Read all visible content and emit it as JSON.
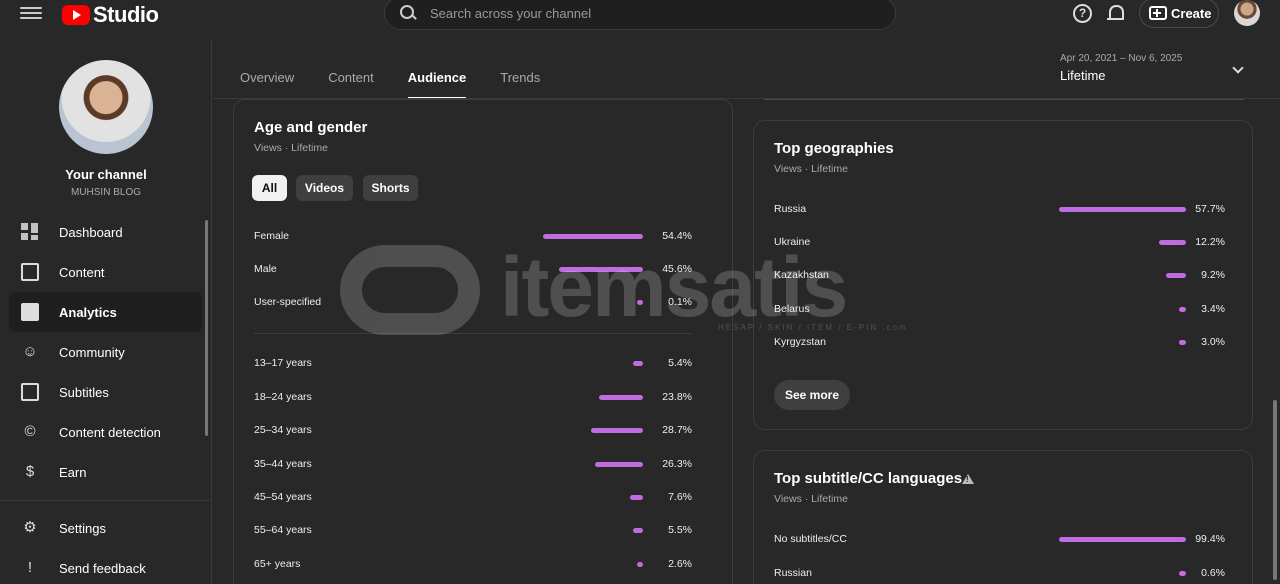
{
  "header": {
    "logo_text": "Studio",
    "search_placeholder": "Search across your channel",
    "help_glyph": "?",
    "create_label": "Create"
  },
  "sidebar": {
    "channel_title": "Your channel",
    "channel_name": "MUHSIN BLOG",
    "items": [
      {
        "label": "Dashboard",
        "icon": "dashboard-icon"
      },
      {
        "label": "Content",
        "icon": "content-icon"
      },
      {
        "label": "Analytics",
        "icon": "analytics-icon"
      },
      {
        "label": "Community",
        "icon": "community-icon"
      },
      {
        "label": "Subtitles",
        "icon": "subtitles-icon"
      },
      {
        "label": "Content detection",
        "icon": "copyright-icon"
      },
      {
        "label": "Earn",
        "icon": "dollar-icon"
      }
    ],
    "bottom_items": [
      {
        "label": "Settings",
        "icon": "gear-icon"
      },
      {
        "label": "Send feedback",
        "icon": "feedback-icon"
      }
    ]
  },
  "tabs": [
    "Overview",
    "Content",
    "Audience",
    "Trends"
  ],
  "date_range": {
    "range": "Apr 20, 2021 – Nov 6, 2025",
    "label": "Lifetime"
  },
  "age_gender": {
    "title": "Age and gender",
    "subtitle": "Views · Lifetime",
    "chips": [
      "All",
      "Videos",
      "Shorts"
    ],
    "gender": [
      {
        "label": "Female",
        "pct": "54.4%"
      },
      {
        "label": "Male",
        "pct": "45.6%"
      },
      {
        "label": "User-specified",
        "pct": "0.1%"
      }
    ],
    "ages": [
      {
        "label": "13–17 years",
        "pct": "5.4%"
      },
      {
        "label": "18–24 years",
        "pct": "23.8%"
      },
      {
        "label": "25–34 years",
        "pct": "28.7%"
      },
      {
        "label": "35–44 years",
        "pct": "26.3%"
      },
      {
        "label": "45–54 years",
        "pct": "7.6%"
      },
      {
        "label": "55–64 years",
        "pct": "5.5%"
      },
      {
        "label": "65+ years",
        "pct": "2.6%"
      }
    ]
  },
  "geographies": {
    "title": "Top geographies",
    "subtitle": "Views · Lifetime",
    "rows": [
      {
        "label": "Russia",
        "pct": "57.7%"
      },
      {
        "label": "Ukraine",
        "pct": "12.2%"
      },
      {
        "label": "Kazakhstan",
        "pct": "9.2%"
      },
      {
        "label": "Belarus",
        "pct": "3.4%"
      },
      {
        "label": "Kyrgyzstan",
        "pct": "3.0%"
      }
    ],
    "see_more": "See more"
  },
  "subtitles": {
    "title": "Top subtitle/CC languages",
    "subtitle": "Views · Lifetime",
    "rows": [
      {
        "label": "No subtitles/CC",
        "pct": "99.4%"
      },
      {
        "label": "Russian",
        "pct": "0.6%"
      }
    ]
  },
  "watermark": {
    "text": "itemsatis",
    "sub": "HESAP / SKIN / ITEM / E-PIN",
    "suffix": ".com"
  },
  "colors": {
    "bar": "#c06be0",
    "background": "#282828"
  }
}
